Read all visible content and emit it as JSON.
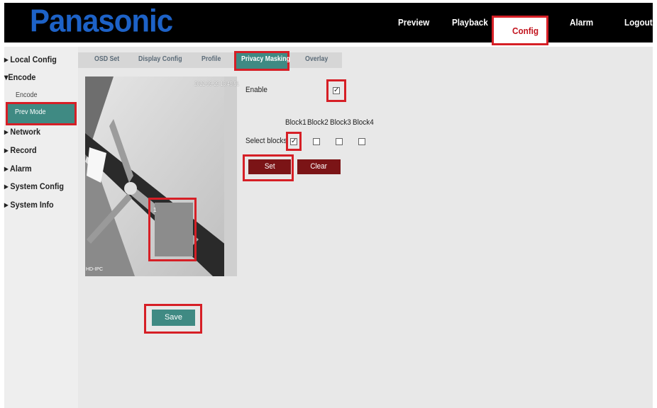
{
  "brand": {
    "logo_text": "Panasonic"
  },
  "nav": {
    "preview": "Preview",
    "playback": "Playback",
    "config": "Config",
    "alarm": "Alarm",
    "logout": "Logout"
  },
  "sidebar": {
    "local_config": "Local Config",
    "encode": "Encode",
    "encode_sub": "Encode",
    "prev_mode": "Prev Mode",
    "network": "Network",
    "record": "Record",
    "alarm": "Alarm",
    "system_config": "System Config",
    "system_info": "System Info"
  },
  "tabs": {
    "osd_set": "OSD Set",
    "display_config": "Display Config",
    "profile": "Profile",
    "privacy_masking": "Privacy Masking",
    "overlay": "Overlay"
  },
  "video": {
    "timestamp": "2022-09-29 13:45:51",
    "camera_id": "HD-IPC",
    "mask_label": "1"
  },
  "form": {
    "enable_label": "Enable",
    "enable_checked": "✓",
    "blocks": [
      "Block1",
      "Block2",
      "Block3",
      "Block4"
    ],
    "select_blocks_label": "Select blocks",
    "block1_checked": "✓",
    "set_button": "Set",
    "clear_button": "Clear",
    "save_button": "Save"
  },
  "colors": {
    "accent_teal": "#3f8a83",
    "dark_red": "#7b1416",
    "highlight_red": "#d61f26",
    "brand_blue": "#1d62c7"
  }
}
